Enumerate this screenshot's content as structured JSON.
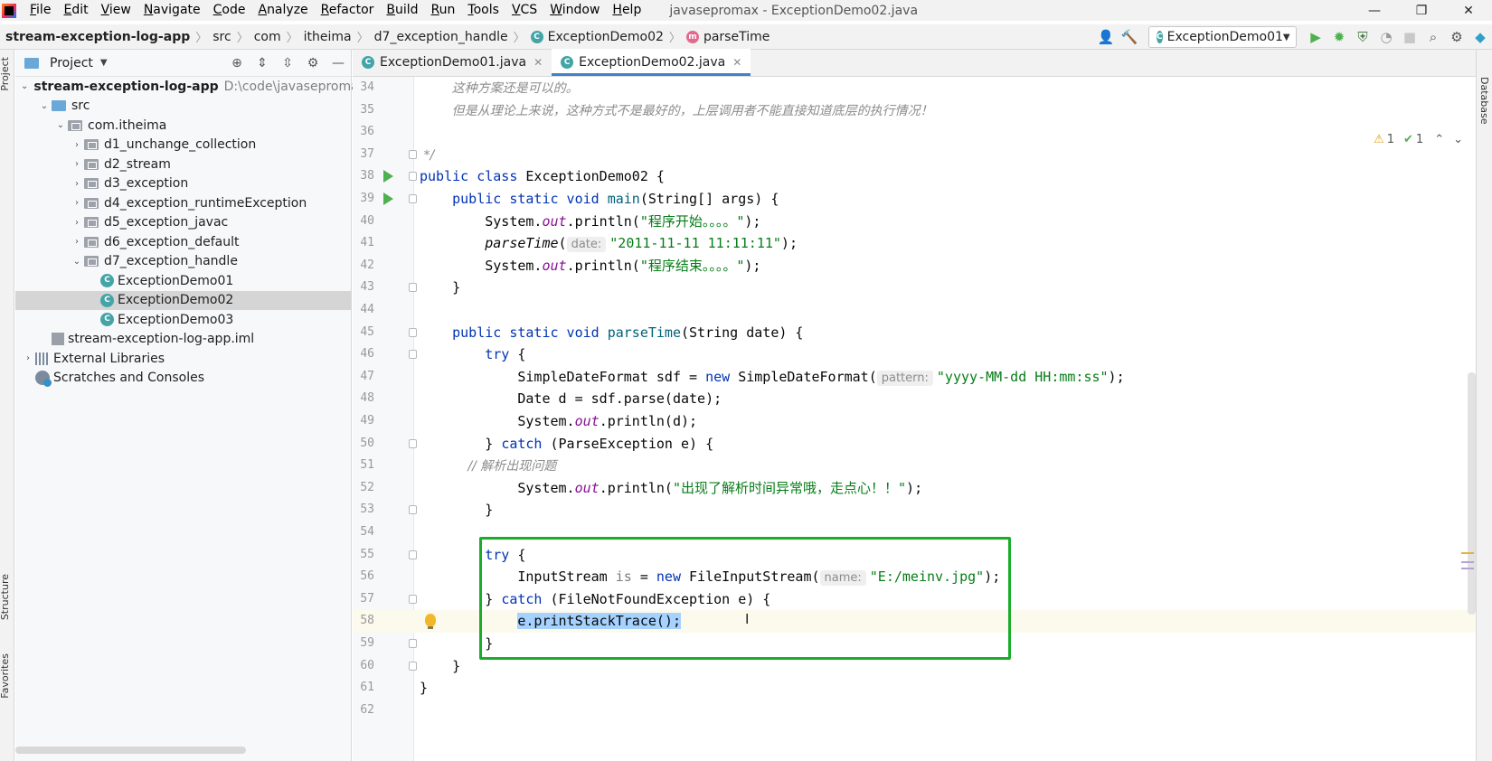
{
  "menubar": {
    "items": [
      "File",
      "Edit",
      "View",
      "Navigate",
      "Code",
      "Analyze",
      "Refactor",
      "Build",
      "Run",
      "Tools",
      "VCS",
      "Window",
      "Help"
    ],
    "window_title": "javasepromax - ExceptionDemo02.java",
    "controls": [
      "—",
      "❐",
      "✕"
    ]
  },
  "breadcrumb": {
    "items": [
      "stream-exception-log-app",
      "src",
      "com",
      "itheima",
      "d7_exception_handle",
      "ExceptionDemo02",
      "parseTime"
    ]
  },
  "run_config": {
    "name": "ExceptionDemo01"
  },
  "left_strip": {
    "project": "Project",
    "structure": "Structure",
    "favorites": "Favorites"
  },
  "right_strip": {
    "database": "Database"
  },
  "project_pane": {
    "title": "Project",
    "tree": [
      {
        "label": "stream-exception-log-app",
        "path": "D:\\code\\javasepromax\\",
        "indent": 0,
        "expanded": true,
        "kind": "module"
      },
      {
        "label": "src",
        "indent": 1,
        "expanded": true,
        "kind": "src"
      },
      {
        "label": "com.itheima",
        "indent": 2,
        "expanded": true,
        "kind": "pkg"
      },
      {
        "label": "d1_unchange_collection",
        "indent": 3,
        "expanded": false,
        "kind": "pkg"
      },
      {
        "label": "d2_stream",
        "indent": 3,
        "expanded": false,
        "kind": "pkg"
      },
      {
        "label": "d3_exception",
        "indent": 3,
        "expanded": false,
        "kind": "pkg"
      },
      {
        "label": "d4_exception_runtimeException",
        "indent": 3,
        "expanded": false,
        "kind": "pkg"
      },
      {
        "label": "d5_exception_javac",
        "indent": 3,
        "expanded": false,
        "kind": "pkg"
      },
      {
        "label": "d6_exception_default",
        "indent": 3,
        "expanded": false,
        "kind": "pkg"
      },
      {
        "label": "d7_exception_handle",
        "indent": 3,
        "expanded": true,
        "kind": "pkg"
      },
      {
        "label": "ExceptionDemo01",
        "indent": 4,
        "kind": "class"
      },
      {
        "label": "ExceptionDemo02",
        "indent": 4,
        "kind": "class",
        "selected": true
      },
      {
        "label": "ExceptionDemo03",
        "indent": 4,
        "kind": "class"
      },
      {
        "label": "stream-exception-log-app.iml",
        "indent": 1,
        "kind": "file"
      },
      {
        "label": "External Libraries",
        "indent": 0,
        "expanded": false,
        "kind": "lib"
      },
      {
        "label": "Scratches and Consoles",
        "indent": 0,
        "kind": "scratch"
      }
    ]
  },
  "editor": {
    "tabs": [
      {
        "label": "ExceptionDemo01.java",
        "active": false
      },
      {
        "label": "ExceptionDemo02.java",
        "active": true
      }
    ],
    "inspections": {
      "warnings": "1",
      "weak_warnings": "1"
    },
    "lines": [
      {
        "n": "34",
        "parts": [
          [
            "cm",
            "        这种方案还是可以的。"
          ]
        ]
      },
      {
        "n": "35",
        "parts": [
          [
            "cm",
            "        但是从理论上来说，这种方式不是最好的，上层调用者不能直接知道底层的执行情况！"
          ]
        ]
      },
      {
        "n": "36",
        "parts": []
      },
      {
        "n": "37",
        "parts": [
          [
            "cm",
            " */"
          ]
        ]
      },
      {
        "n": "38",
        "parts": [
          [
            "kw",
            "public class "
          ],
          [
            "",
            "ExceptionDemo02 {"
          ]
        ],
        "run": true
      },
      {
        "n": "39",
        "parts": [
          [
            "kw",
            "    public static void "
          ],
          [
            "mth",
            "main"
          ],
          [
            "",
            "(String[] args) {"
          ]
        ],
        "run": true
      },
      {
        "n": "40",
        "parts": [
          [
            "",
            "        System."
          ],
          [
            "fld",
            "out"
          ],
          [
            "",
            ".println("
          ],
          [
            "str",
            "\"程序开始。。。。\""
          ],
          [
            "",
            ");"
          ]
        ]
      },
      {
        "n": "41",
        "parts": [
          [
            "itl",
            "        parseTime"
          ],
          [
            "",
            "("
          ],
          [
            "hint",
            "date:"
          ],
          [
            "str",
            "\"2011-11-11 11:11:11\""
          ],
          [
            "",
            ");"
          ]
        ]
      },
      {
        "n": "42",
        "parts": [
          [
            "",
            "        System."
          ],
          [
            "fld",
            "out"
          ],
          [
            "",
            ".println("
          ],
          [
            "str",
            "\"程序结束。。。。\""
          ],
          [
            "",
            ");"
          ]
        ]
      },
      {
        "n": "43",
        "parts": [
          [
            "",
            "    }"
          ]
        ]
      },
      {
        "n": "44",
        "parts": []
      },
      {
        "n": "45",
        "parts": [
          [
            "kw",
            "    public static void "
          ],
          [
            "mth",
            "parseTime"
          ],
          [
            "",
            "(String date) {"
          ]
        ]
      },
      {
        "n": "46",
        "parts": [
          [
            "kw",
            "        try "
          ],
          [
            "",
            "{"
          ]
        ]
      },
      {
        "n": "47",
        "parts": [
          [
            "",
            "            SimpleDateFormat sdf = "
          ],
          [
            "kw",
            "new "
          ],
          [
            "",
            "SimpleDateFormat("
          ],
          [
            "hint",
            "pattern:"
          ],
          [
            "str",
            "\"yyyy-MM-dd HH:mm:ss\""
          ],
          [
            "",
            ");"
          ]
        ]
      },
      {
        "n": "48",
        "parts": [
          [
            "",
            "            Date d = sdf.parse(date);"
          ]
        ]
      },
      {
        "n": "49",
        "parts": [
          [
            "",
            "            System."
          ],
          [
            "fld",
            "out"
          ],
          [
            "",
            ".println(d);"
          ]
        ]
      },
      {
        "n": "50",
        "parts": [
          [
            "",
            "        } "
          ],
          [
            "kw",
            "catch "
          ],
          [
            "",
            "(ParseException e) {"
          ]
        ]
      },
      {
        "n": "51",
        "parts": [
          [
            "cm",
            "            // 解析出现问题"
          ]
        ]
      },
      {
        "n": "52",
        "parts": [
          [
            "",
            "            System."
          ],
          [
            "fld",
            "out"
          ],
          [
            "",
            ".println("
          ],
          [
            "str",
            "\"出现了解析时间异常哦，走点心！！\""
          ],
          [
            "",
            ");"
          ]
        ]
      },
      {
        "n": "53",
        "parts": [
          [
            "",
            "        }"
          ]
        ]
      },
      {
        "n": "54",
        "parts": []
      },
      {
        "n": "55",
        "parts": [
          [
            "kw",
            "        try "
          ],
          [
            "",
            "{"
          ]
        ]
      },
      {
        "n": "56",
        "parts": [
          [
            "",
            "            InputStream "
          ],
          [
            "unused",
            "is"
          ],
          [
            "",
            " = "
          ],
          [
            "kw",
            "new "
          ],
          [
            "",
            "FileInputStream("
          ],
          [
            "hint",
            "name:"
          ],
          [
            "str",
            "\"E:/meinv.jpg\""
          ],
          [
            "",
            ");"
          ]
        ]
      },
      {
        "n": "57",
        "parts": [
          [
            "",
            "        } "
          ],
          [
            "kw",
            "catch "
          ],
          [
            "",
            "(FileNotFoundException e) {"
          ]
        ]
      },
      {
        "n": "58",
        "parts": [
          [
            "",
            "            "
          ],
          [
            "sel",
            "e.printStackTrace();"
          ]
        ],
        "current": true,
        "bulb": true
      },
      {
        "n": "59",
        "parts": [
          [
            "",
            "        }"
          ]
        ]
      },
      {
        "n": "60",
        "parts": [
          [
            "",
            "    }"
          ]
        ]
      },
      {
        "n": "61",
        "parts": [
          [
            "",
            "}"
          ]
        ]
      },
      {
        "n": "62",
        "parts": []
      }
    ]
  },
  "colors": {
    "accent": "#4083c9",
    "highlight_box": "#1aad2a",
    "selection": "#a6d2ff"
  }
}
